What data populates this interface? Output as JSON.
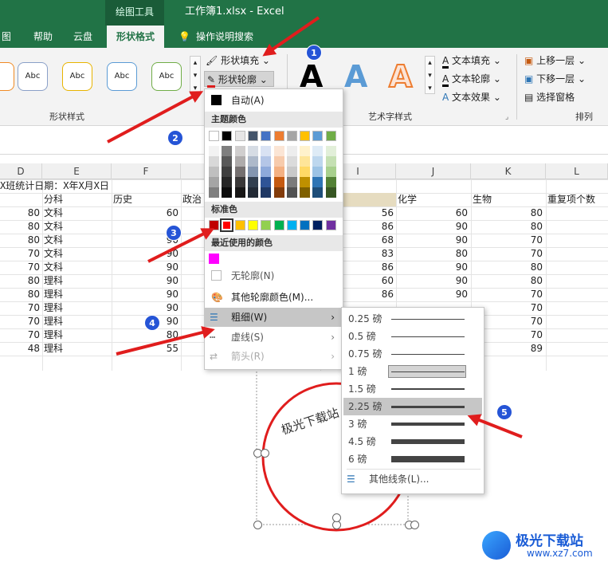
{
  "app": {
    "context_tab": "绘图工具",
    "doc_title": "工作簿1.xlsx  -  Excel"
  },
  "tabs": [
    "图",
    "帮助",
    "云盘",
    "形状格式",
    "操作说明搜索"
  ],
  "ribbon": {
    "style_samples": [
      "Abc",
      "Abc",
      "Abc",
      "Abc"
    ],
    "shape_fill": "形状填充",
    "shape_outline": "形状轮廓",
    "group_shape_styles": "形状样式",
    "group_wordart": "艺术字样式",
    "group_arrange": "排列",
    "text_fill": "文本填充",
    "text_outline": "文本轮廓",
    "text_effects": "文本效果",
    "bring_forward": "上移一层",
    "send_backward": "下移一层",
    "selection_pane": "选择窗格"
  },
  "columns": [
    "D",
    "E",
    "F",
    "I",
    "J",
    "K",
    "L"
  ],
  "sheet": {
    "title_cell": "X班统计日期：X年X月X日",
    "headers": {
      "e": "分科",
      "f": "历史",
      "g": "政治",
      "j": "化学",
      "k": "生物",
      "l": "重复项个数"
    },
    "rows": [
      {
        "d": "80",
        "e": "文科",
        "f": "60",
        "i": "56",
        "j": "60",
        "k": "80"
      },
      {
        "d": "80",
        "e": "文科",
        "f": "",
        "i": "86",
        "j": "90",
        "k": "80"
      },
      {
        "d": "80",
        "e": "文科",
        "f": "90",
        "i": "68",
        "j": "90",
        "k": "70"
      },
      {
        "d": "70",
        "e": "文科",
        "f": "90",
        "i": "83",
        "j": "80",
        "k": "70"
      },
      {
        "d": "70",
        "e": "文科",
        "f": "90",
        "i": "86",
        "j": "90",
        "k": "80"
      },
      {
        "d": "80",
        "e": "理科",
        "f": "90",
        "i": "60",
        "j": "90",
        "k": "80"
      },
      {
        "d": "80",
        "e": "理科",
        "f": "90",
        "i": "86",
        "j": "90",
        "k": "70"
      },
      {
        "d": "70",
        "e": "理科",
        "f": "90",
        "i": "",
        "j": "",
        "k": "70"
      },
      {
        "d": "70",
        "e": "理科",
        "f": "90",
        "i": "",
        "j": "",
        "k": "70"
      },
      {
        "d": "70",
        "e": "理科",
        "f": "80",
        "i": "",
        "j": "",
        "k": "70"
      },
      {
        "d": "48",
        "e": "理科",
        "f": "55",
        "i": "",
        "j": "",
        "k": "89"
      }
    ]
  },
  "shape_text": "极光下载站",
  "outline_menu": {
    "auto": "自动(A)",
    "theme_colors": "主题颜色",
    "standard_colors": "标准色",
    "recent_colors": "最近使用的颜色",
    "no_outline": "无轮廓(N)",
    "more_colors": "其他轮廓颜色(M)...",
    "weight": "粗细(W)",
    "dashes": "虚线(S)",
    "arrows": "箭头(R)",
    "theme_top": [
      "#ffffff",
      "#000000",
      "#e7e6e6",
      "#44546a",
      "#4472c4",
      "#ed7d31",
      "#a5a5a5",
      "#ffc000",
      "#5b9bd5",
      "#70ad47"
    ],
    "theme_shades": [
      [
        "#f2f2f2",
        "#7f7f7f",
        "#d0cece",
        "#d6dce4",
        "#d9e2f3",
        "#fbe5d5",
        "#ededed",
        "#fff2cc",
        "#deebf6",
        "#e2efd9"
      ],
      [
        "#d8d8d8",
        "#595959",
        "#aeabab",
        "#adb9ca",
        "#b4c6e7",
        "#f7cbac",
        "#dbdbdb",
        "#fee599",
        "#bdd7ee",
        "#c5e0b3"
      ],
      [
        "#bfbfbf",
        "#3f3f3f",
        "#757070",
        "#8496b0",
        "#8eaadb",
        "#f4b183",
        "#c9c9c9",
        "#ffd965",
        "#9cc3e5",
        "#a8d08d"
      ],
      [
        "#a5a5a5",
        "#262626",
        "#3a3838",
        "#323f4f",
        "#2f5496",
        "#c55a11",
        "#7b7b7b",
        "#bf9000",
        "#2e75b5",
        "#538135"
      ],
      [
        "#7f7f7f",
        "#0c0c0c",
        "#171616",
        "#222a35",
        "#1f3864",
        "#833c0b",
        "#525252",
        "#7f6000",
        "#1e4e79",
        "#375623"
      ]
    ],
    "standard": [
      "#c00000",
      "#ff0000",
      "#ffc000",
      "#ffff00",
      "#92d050",
      "#00b050",
      "#00b0f0",
      "#0070c0",
      "#002060",
      "#7030a0"
    ],
    "recent": [
      "#ff00ff"
    ],
    "auto_color": "#000000"
  },
  "weight_menu": {
    "items": [
      {
        "label": "0.25 磅",
        "w": 0.25
      },
      {
        "label": "0.5 磅",
        "w": 0.5
      },
      {
        "label": "0.75 磅",
        "w": 0.75
      },
      {
        "label": "1 磅",
        "w": 1
      },
      {
        "label": "1.5 磅",
        "w": 1.5
      },
      {
        "label": "2.25 磅",
        "w": 2.25
      },
      {
        "label": "3 磅",
        "w": 3
      },
      {
        "label": "4.5 磅",
        "w": 4.5
      },
      {
        "label": "6 磅",
        "w": 6
      }
    ],
    "more": "其他线条(L)..."
  },
  "badges": [
    "1",
    "2",
    "3",
    "4",
    "5"
  ],
  "watermark": {
    "text": "极光下载站",
    "url": "www.xz7.com"
  }
}
